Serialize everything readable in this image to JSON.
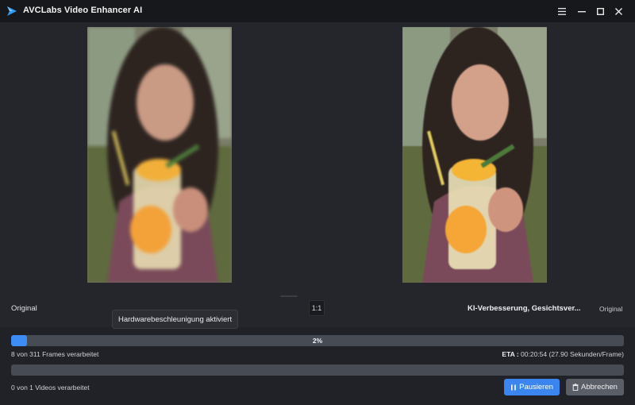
{
  "window": {
    "title": "AVCLabs Video Enhancer AI",
    "controls": [
      "menu-icon",
      "minimize-icon",
      "maximize-icon",
      "close-icon"
    ]
  },
  "preview": {
    "left_label": "Original",
    "ratio_button": "1:1",
    "right_label": "KI-Verbesserung, Gesichtsver...",
    "right_original_label": "Original",
    "tooltip": "Hardwarebeschleunigung aktiviert"
  },
  "progress": {
    "percent_value": 0.02,
    "percent_label": "2%",
    "frames_text": "8 von 311 Frames verarbeitet",
    "eta_label": "ETA :",
    "eta_value": "00:20:54 (27.90 Sekunden/Frame)",
    "videos_text": "0 von 1 Videos verarbeitet"
  },
  "actions": {
    "pause_label": "Pausieren",
    "cancel_label": "Abbrechen"
  },
  "colors": {
    "accent": "#3a86ee",
    "background": "#1f2126",
    "titlebar": "#17181c"
  }
}
